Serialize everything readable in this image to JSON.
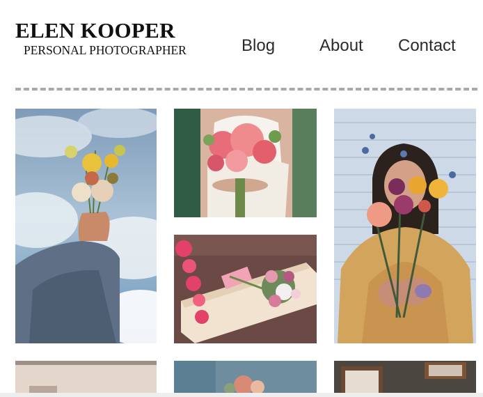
{
  "brand": {
    "name": "ELEN KOOPER",
    "tagline": "PERSONAL PHOTOGRAPHER"
  },
  "nav": {
    "items": [
      {
        "label": "Blog"
      },
      {
        "label": "About"
      },
      {
        "label": "Contact"
      }
    ]
  },
  "gallery": {
    "photos": [
      {
        "subject": "hand-holding-wildflowers-sky"
      },
      {
        "subject": "bride-pink-rose-bouquet"
      },
      {
        "subject": "woman-holding-flowers-yellow-jacket"
      },
      {
        "subject": "bouquet-on-wooden-board"
      },
      {
        "subject": "interior-partial"
      },
      {
        "subject": "flowers-partial"
      },
      {
        "subject": "frames-partial"
      }
    ]
  },
  "colors": {
    "text": "#111111",
    "nav_text": "#2b2b2b",
    "divider": "#a9a9a9"
  }
}
